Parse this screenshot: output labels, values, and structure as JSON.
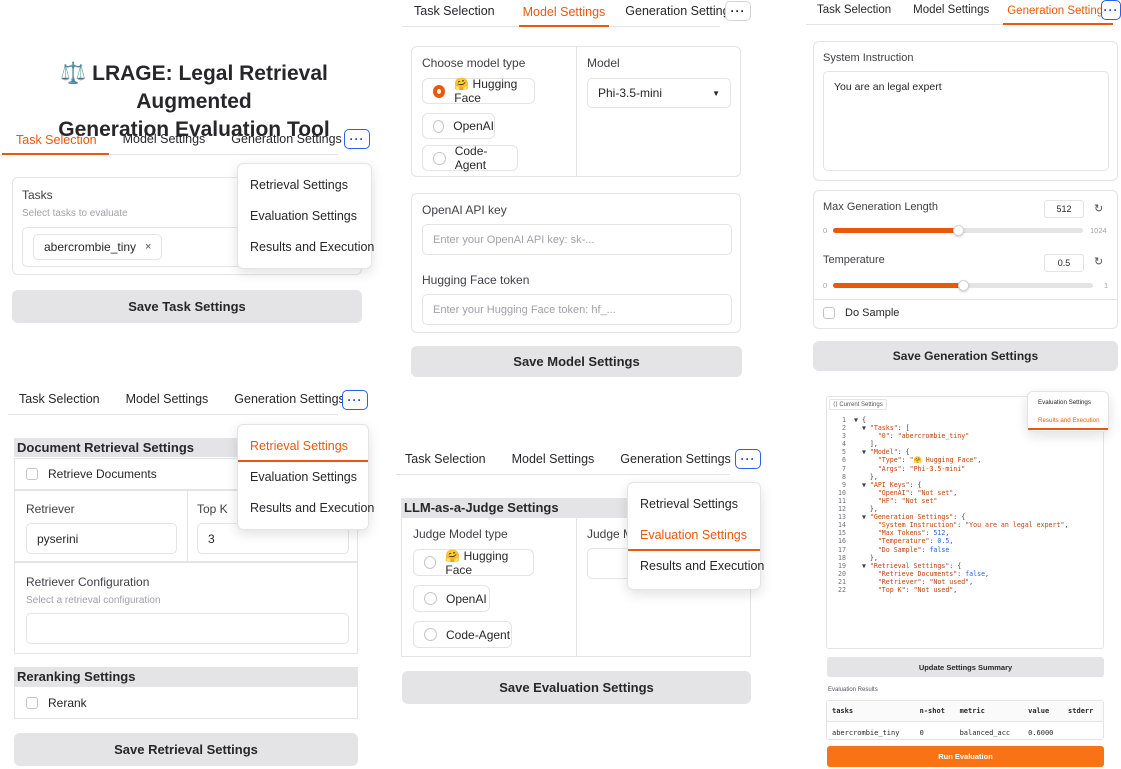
{
  "app": {
    "title_line1": "⚖️ LRAGE: Legal Retrieval Augmented",
    "title_line2": "Generation Evaluation Tool"
  },
  "tabs": {
    "task": "Task Selection",
    "model": "Model Settings",
    "generation": "Generation Settings",
    "more": "···"
  },
  "menu": {
    "retrieval": "Retrieval Settings",
    "evaluation": "Evaluation Settings",
    "results": "Results and Execution"
  },
  "task_panel": {
    "tasks_label": "Tasks",
    "tasks_sub": "Select tasks to evaluate",
    "selected_task": "abercrombie_tiny",
    "remove_symbol": "×",
    "save": "Save Task Settings"
  },
  "model_panel": {
    "choose_type": "Choose model type",
    "options": [
      "🤗 Hugging Face",
      "OpenAI",
      "Code-Agent"
    ],
    "model_label": "Model",
    "model_value": "Phi-3.5-mini",
    "openai_label": "OpenAI API key",
    "openai_placeholder": "Enter your OpenAI API key: sk-...",
    "hf_label": "Hugging Face token",
    "hf_placeholder": "Enter your Hugging Face token: hf_...",
    "save": "Save Model Settings"
  },
  "generation_panel": {
    "system_label": "System Instruction",
    "system_value": "You are an legal expert",
    "max_len_label": "Max Generation Length",
    "max_len_value": "512",
    "max_len_min": "0",
    "max_len_max": "1024",
    "max_len_fraction": 0.5,
    "temp_label": "Temperature",
    "temp_value": "0.5",
    "temp_min": "0",
    "temp_max": "1",
    "temp_fraction": 0.5,
    "do_sample": "Do Sample",
    "reset_symbol": "↻",
    "save": "Save Generation Settings"
  },
  "retrieval_panel": {
    "doc_title": "Document Retrieval Settings",
    "retrieve_docs": "Retrieve Documents",
    "retriever_label": "Retriever",
    "retriever_value": "pyserini",
    "topk_label": "Top K",
    "topk_value": "3",
    "config_label": "Retriever Configuration",
    "config_sub": "Select a retrieval configuration",
    "rerank_title": "Reranking Settings",
    "rerank": "Rerank",
    "save": "Save Retrieval Settings"
  },
  "judge_panel": {
    "title": "LLM-as-a-Judge Settings",
    "type_label": "Judge Model type",
    "model_label_partial": "Judge M",
    "options": [
      "🤗 Hugging Face",
      "OpenAI",
      "Code-Agent"
    ],
    "save": "Save Evaluation Settings"
  },
  "results_panel": {
    "current_label": "⟨⟩ Current Settings",
    "code_lines": [
      "▼ {",
      "  ▼ \"Tasks\": [",
      "      \"0\": \"abercrombie_tiny\"",
      "    ],",
      "  ▼ \"Model\": {",
      "      \"Type\": \"🤗 Hugging Face\",",
      "      \"Args\": \"Phi-3.5-mini\"",
      "    },",
      "  ▼ \"API Keys\": {",
      "      \"OpenAI\": \"Not set\",",
      "      \"HF\": \"Not set\"",
      "    },",
      "  ▼ \"Generation Settings\": {",
      "      \"System Instruction\": \"You are an legal expert\",",
      "      \"Max Tokens\": 512,",
      "      \"Temperature\": 0.5,",
      "      \"Do Sample\": false",
      "    },",
      "  ▼ \"Retrieval Settings\": {",
      "      \"Retrieve Documents\": false,",
      "      \"Retriever\": \"Not used\",",
      "      \"Top K\": \"Not used\","
    ],
    "update": "Update Settings Summary",
    "eval_results": "Evaluation Results",
    "headers": [
      "tasks",
      "n-shot",
      "metric",
      "value",
      "stderr"
    ],
    "row": [
      "abercrombie_tiny",
      "0",
      "balanced_acc",
      "0.6000",
      ""
    ],
    "run": "Run Evaluation"
  }
}
